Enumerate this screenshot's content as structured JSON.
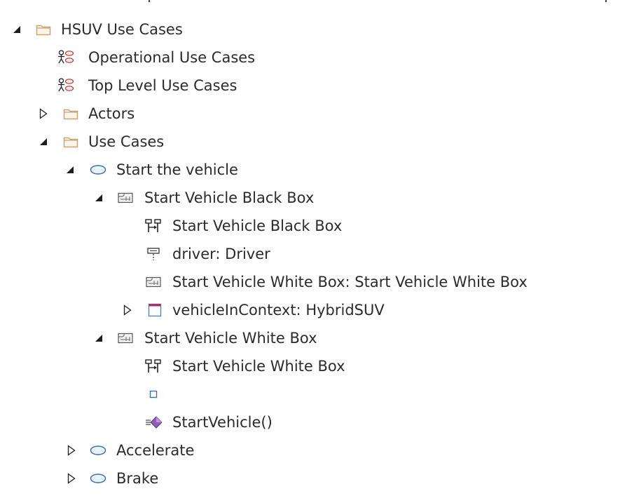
{
  "tree": {
    "nodes": [
      {
        "label": "HSUV Use Cases",
        "icon": "folder-icon",
        "state": "expanded"
      },
      {
        "label": "Operational Use Cases",
        "icon": "use-case-diagram-icon",
        "state": "leaf"
      },
      {
        "label": "Top Level Use Cases",
        "icon": "use-case-diagram-icon",
        "state": "leaf"
      },
      {
        "label": "Actors",
        "icon": "folder-icon",
        "state": "collapsed"
      },
      {
        "label": "Use Cases",
        "icon": "folder-icon",
        "state": "expanded"
      },
      {
        "label": "Start the vehicle",
        "icon": "use-case-icon",
        "state": "expanded"
      },
      {
        "label": "Start Vehicle Black Box",
        "icon": "interaction-icon",
        "state": "expanded"
      },
      {
        "label": "Start Vehicle Black Box",
        "icon": "sequence-diagram-icon",
        "state": "leaf"
      },
      {
        "label": "driver: Driver",
        "icon": "lifeline-icon",
        "state": "leaf"
      },
      {
        "label": "Start Vehicle White Box: Start Vehicle White Box",
        "icon": "interaction-icon",
        "state": "leaf"
      },
      {
        "label": "vehicleInContext: HybridSUV",
        "icon": "block-property-icon",
        "state": "collapsed"
      },
      {
        "label": "Start Vehicle White Box",
        "icon": "interaction-icon",
        "state": "expanded"
      },
      {
        "label": "Start Vehicle White Box",
        "icon": "sequence-diagram-icon",
        "state": "leaf"
      },
      {
        "label": "",
        "icon": "gate-icon",
        "state": "leaf"
      },
      {
        "label": "StartVehicle()",
        "icon": "message-operation-icon",
        "state": "leaf"
      },
      {
        "label": "Accelerate",
        "icon": "use-case-icon",
        "state": "collapsed"
      },
      {
        "label": "Brake",
        "icon": "use-case-icon",
        "state": "collapsed"
      }
    ]
  },
  "colors": {
    "folder": "#c8a477",
    "use_case": "#3d6fb3",
    "message_diamond": "#8b5fb5",
    "block_header": "#b3245a",
    "text": "#2b2b2b"
  }
}
